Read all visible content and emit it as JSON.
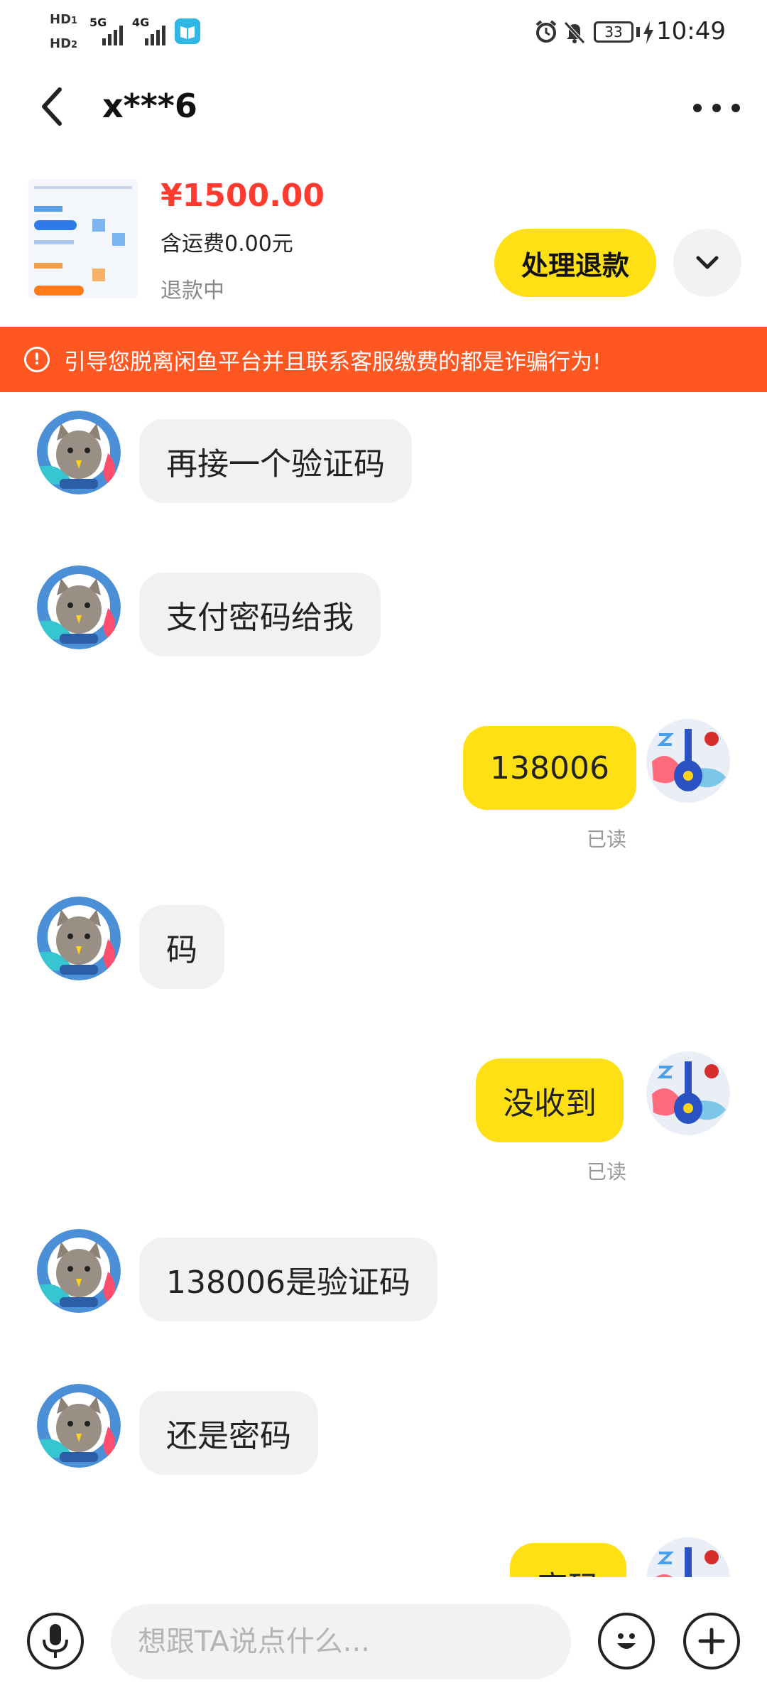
{
  "status_bar": {
    "hd1": "HD",
    "hd1_sub": "1",
    "hd2": "HD",
    "hd2_sub": "2",
    "net1": "5G",
    "net2": "4G",
    "battery": "33",
    "time": "10:49"
  },
  "header": {
    "title": "x***6",
    "back_icon": "chevron-left-icon",
    "more_icon": "more-dots-icon"
  },
  "product": {
    "price": "¥1500.00",
    "shipping": "含运费0.00元",
    "status": "退款中",
    "action_label": "处理退款"
  },
  "banner": {
    "icon": "!",
    "text": "引导您脱离闲鱼平台并且联系客服缴费的都是诈骗行为!"
  },
  "messages": [
    {
      "side": "in",
      "text": "再接一个验证码"
    },
    {
      "side": "in",
      "text": "支付密码给我"
    },
    {
      "side": "out",
      "text": "138006",
      "receipt": "已读"
    },
    {
      "side": "in",
      "text": "码"
    },
    {
      "side": "out",
      "text": "没收到",
      "receipt": "已读"
    },
    {
      "side": "in",
      "text": "138006是验证码"
    },
    {
      "side": "in",
      "text": "还是密码"
    },
    {
      "side": "out",
      "text": "密码"
    }
  ],
  "input": {
    "placeholder": "想跟TA说点什么..."
  },
  "colors": {
    "accent_yellow": "#ffe014",
    "price_red": "#ff3b30",
    "banner_orange": "#ff5722"
  }
}
